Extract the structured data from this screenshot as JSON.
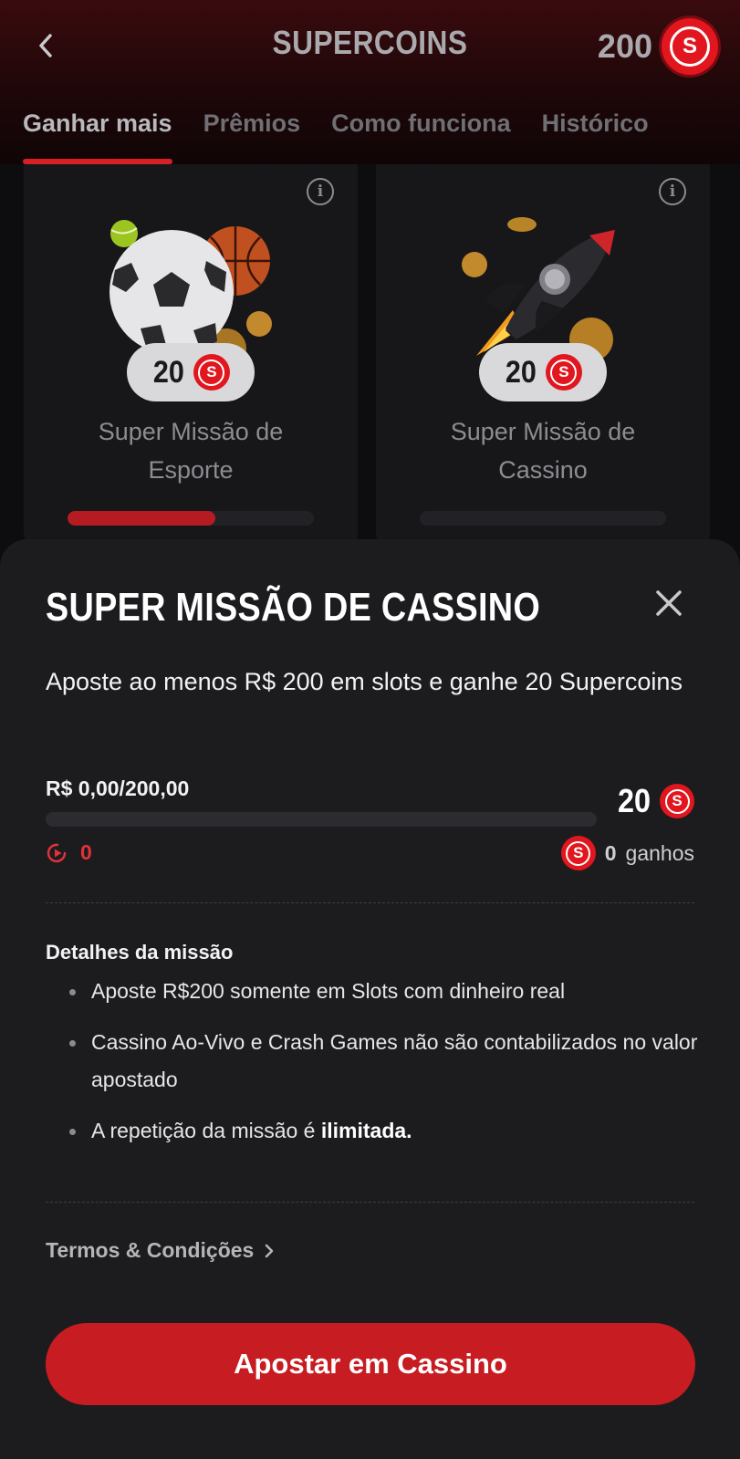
{
  "header": {
    "title": "SUPERCOINS",
    "balance": "200",
    "coin_symbol": "S"
  },
  "tabs": [
    {
      "label": "Ganhar mais",
      "active": true
    },
    {
      "label": "Prêmios",
      "active": false
    },
    {
      "label": "Como funciona",
      "active": false
    },
    {
      "label": "Histórico",
      "active": false
    }
  ],
  "cards": [
    {
      "title_line1": "Super Missão de",
      "title_line2": "Esporte",
      "reward": "20",
      "progress": 0.6
    },
    {
      "title_line1": "Super Missão de",
      "title_line2": "Cassino",
      "reward": "20",
      "progress": 0
    }
  ],
  "sheet": {
    "title": "SUPER MISSÃO DE CASSINO",
    "description": "Aposte ao menos R$ 200 em slots e ganhe 20 Supercoins",
    "progress_label": "R$ 0,00/200,00",
    "progress_value": 0,
    "reward": "20",
    "plays_count": "0",
    "earned_count": "0",
    "earned_label": "ganhos",
    "details_title": "Detalhes da missão",
    "details": [
      {
        "text": "Aposte R$200 somente em Slots com dinheiro real"
      },
      {
        "text": "Cassino Ao-Vivo e Crash Games não são contabilizados no valor apostado"
      },
      {
        "text": "A repetição da missão é ",
        "bold": "ilimitada."
      }
    ],
    "terms_label": "Termos & Condições",
    "cta_label": "Apostar em Cassino"
  },
  "colors": {
    "accent": "#d71f26",
    "coin": "#e1161e",
    "background": "#0d0d0f",
    "sheet": "#1c1c1f"
  },
  "icons": [
    "back-icon",
    "supercoin-icon",
    "info-icon",
    "close-icon",
    "play-icon",
    "chevron-right-icon"
  ]
}
